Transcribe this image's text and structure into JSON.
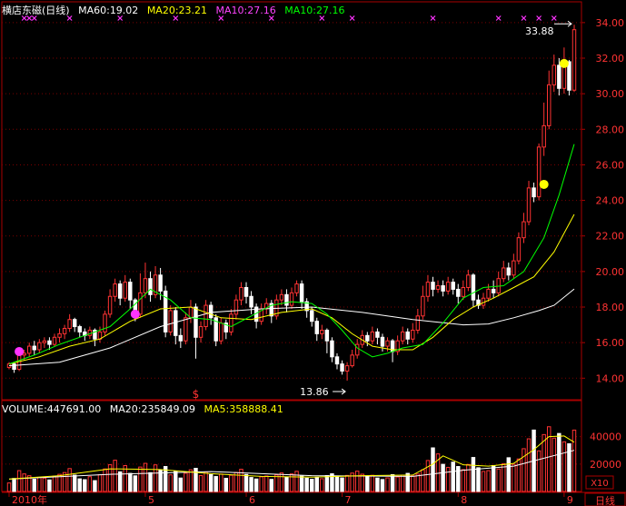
{
  "header": {
    "stock_name": "横店东磁(日线)",
    "indicators": [
      {
        "label": "MA60:19.02",
        "color": "#ffffff"
      },
      {
        "label": "MA20:23.21",
        "color": "#ffff00"
      },
      {
        "label": "MA10:27.16",
        "color": "#ff44ff"
      },
      {
        "label": "MA10:27.16",
        "color": "#00ff00"
      }
    ]
  },
  "volume_header": {
    "indicators": [
      {
        "label": "VOLUME:447691.00",
        "color": "#ffffff"
      },
      {
        "label": "MA20:235849.09",
        "color": "#ffffff"
      },
      {
        "label": "MA5:358888.41",
        "color": "#ffff00"
      }
    ]
  },
  "colors": {
    "up": "#ff3333",
    "down": "#ffffff",
    "border": "#aa0000",
    "grid": "#7a0000",
    "axis_text": "#ff3333",
    "ma_white": "#ffffff",
    "ma_yellow": "#ffff00",
    "ma_green": "#00ff00",
    "marker_yellow": "#ffff00",
    "marker_magenta": "#ff33ff",
    "signal_mark": "#ff33ff"
  },
  "chart_data": {
    "type": "candlestick",
    "price_axis": {
      "min": 13.3,
      "max": 34.3,
      "ticks": [
        "14.00",
        "16.00",
        "18.00",
        "20.00",
        "22.00",
        "24.00",
        "26.00",
        "28.00",
        "30.00",
        "32.00",
        "34.00"
      ]
    },
    "volume_axis": {
      "max": 55000,
      "ticks": [
        "20000",
        "40000"
      ],
      "unit": "X10"
    },
    "x_axis": {
      "labels": [
        {
          "label": "2010年",
          "index": 0
        },
        {
          "label": "5",
          "index": 27
        },
        {
          "label": "6",
          "index": 47
        },
        {
          "label": "7",
          "index": 66
        },
        {
          "label": "8",
          "index": 89
        },
        {
          "label": "9",
          "index": 110
        }
      ],
      "period_button": "日线"
    },
    "annotations": {
      "low_label": "13.86",
      "high_label": "33.88",
      "low_index": 67,
      "low_price": 13.86,
      "high_index": 112,
      "high_price": 33.88,
      "event_symbol": "$",
      "event_index": 37
    },
    "markers": [
      {
        "index": 2,
        "price": 15.5,
        "color": "magenta"
      },
      {
        "index": 25,
        "price": 17.6,
        "color": "magenta"
      },
      {
        "index": 106,
        "price": 24.9,
        "color": "yellow"
      },
      {
        "index": 110,
        "price": 31.7,
        "color": "yellow"
      }
    ],
    "top_signals": [
      3,
      4,
      5,
      12,
      22,
      33,
      42,
      52,
      62,
      68,
      84,
      97,
      102,
      105,
      108
    ],
    "candles": [
      [
        14.6,
        14.8,
        14.5,
        14.9
      ],
      [
        14.8,
        14.5,
        14.3,
        14.9
      ],
      [
        14.5,
        15.3,
        14.4,
        15.5
      ],
      [
        15.3,
        15.4,
        15.0,
        15.6
      ],
      [
        15.4,
        15.8,
        15.2,
        16.0
      ],
      [
        15.8,
        15.6,
        15.3,
        16.1
      ],
      [
        15.6,
        16.0,
        15.4,
        16.2
      ],
      [
        16.0,
        16.1,
        15.7,
        16.3
      ],
      [
        16.1,
        15.9,
        15.6,
        16.3
      ],
      [
        15.9,
        16.3,
        15.8,
        16.5
      ],
      [
        16.3,
        16.5,
        16.0,
        16.8
      ],
      [
        16.5,
        16.8,
        16.2,
        17.0
      ],
      [
        16.8,
        17.3,
        16.6,
        17.6
      ],
      [
        17.3,
        16.9,
        16.6,
        17.4
      ],
      [
        16.9,
        16.6,
        16.3,
        17.0
      ],
      [
        16.6,
        16.4,
        16.1,
        16.8
      ],
      [
        16.4,
        16.7,
        16.2,
        16.9
      ],
      [
        16.7,
        16.2,
        15.8,
        16.8
      ],
      [
        16.2,
        16.6,
        16.0,
        16.9
      ],
      [
        16.6,
        17.6,
        16.4,
        17.8
      ],
      [
        17.6,
        18.6,
        17.4,
        19.0
      ],
      [
        18.6,
        19.3,
        18.3,
        19.6
      ],
      [
        19.3,
        18.5,
        18.1,
        19.5
      ],
      [
        18.5,
        19.4,
        18.3,
        19.8
      ],
      [
        19.4,
        18.4,
        17.9,
        19.6
      ],
      [
        18.4,
        17.6,
        17.2,
        18.5
      ],
      [
        17.6,
        18.8,
        17.4,
        19.9
      ],
      [
        18.8,
        19.6,
        18.5,
        20.5
      ],
      [
        19.6,
        18.7,
        18.3,
        20.0
      ],
      [
        18.7,
        19.8,
        18.5,
        20.3
      ],
      [
        19.8,
        18.9,
        18.4,
        20.2
      ],
      [
        18.9,
        16.6,
        16.3,
        19.2
      ],
      [
        16.6,
        17.8,
        16.4,
        18.1
      ],
      [
        17.8,
        16.4,
        15.9,
        18.0
      ],
      [
        16.4,
        16.1,
        15.7,
        16.8
      ],
      [
        16.1,
        17.4,
        15.9,
        17.7
      ],
      [
        17.4,
        18.0,
        17.1,
        18.4
      ],
      [
        18.0,
        16.3,
        15.1,
        18.2
      ],
      [
        16.3,
        16.9,
        16.0,
        17.2
      ],
      [
        16.9,
        18.1,
        16.7,
        18.4
      ],
      [
        18.1,
        17.4,
        17.0,
        18.3
      ],
      [
        17.4,
        16.1,
        15.8,
        17.6
      ],
      [
        16.1,
        17.1,
        15.9,
        17.4
      ],
      [
        17.1,
        16.6,
        16.2,
        17.3
      ],
      [
        16.6,
        17.6,
        16.4,
        17.9
      ],
      [
        17.6,
        18.4,
        17.3,
        18.7
      ],
      [
        18.4,
        19.1,
        18.1,
        19.4
      ],
      [
        19.1,
        18.6,
        18.2,
        19.4
      ],
      [
        18.6,
        18.0,
        17.6,
        18.9
      ],
      [
        18.0,
        17.2,
        16.8,
        18.2
      ],
      [
        17.2,
        17.9,
        17.0,
        18.2
      ],
      [
        17.9,
        18.2,
        17.6,
        18.5
      ],
      [
        18.2,
        17.5,
        17.1,
        18.4
      ],
      [
        17.5,
        18.4,
        17.3,
        18.7
      ],
      [
        18.4,
        18.7,
        18.1,
        19.0
      ],
      [
        18.7,
        18.1,
        17.7,
        19.0
      ],
      [
        18.1,
        18.8,
        17.9,
        19.1
      ],
      [
        18.8,
        19.3,
        18.6,
        19.5
      ],
      [
        19.3,
        18.3,
        17.9,
        19.5
      ],
      [
        18.3,
        17.8,
        17.4,
        18.5
      ],
      [
        17.8,
        17.2,
        16.9,
        18.0
      ],
      [
        17.2,
        16.5,
        16.1,
        17.4
      ],
      [
        16.5,
        16.7,
        16.2,
        17.0
      ],
      [
        16.7,
        16.1,
        15.4,
        16.8
      ],
      [
        16.1,
        15.2,
        14.9,
        16.3
      ],
      [
        15.2,
        14.8,
        14.5,
        15.4
      ],
      [
        14.8,
        14.4,
        14.2,
        15.0
      ],
      [
        14.4,
        14.7,
        13.86,
        14.9
      ],
      [
        14.7,
        15.3,
        14.6,
        15.6
      ],
      [
        15.3,
        15.9,
        15.1,
        16.2
      ],
      [
        15.9,
        16.4,
        15.7,
        16.7
      ],
      [
        16.4,
        16.1,
        15.8,
        16.6
      ],
      [
        16.1,
        16.6,
        15.9,
        16.9
      ],
      [
        16.6,
        16.3,
        15.9,
        16.8
      ],
      [
        16.3,
        15.8,
        15.5,
        16.5
      ],
      [
        15.8,
        16.1,
        15.5,
        16.3
      ],
      [
        16.1,
        15.5,
        14.9,
        16.2
      ],
      [
        15.5,
        16.1,
        15.3,
        16.4
      ],
      [
        16.1,
        16.6,
        15.9,
        16.9
      ],
      [
        16.6,
        16.2,
        15.9,
        16.8
      ],
      [
        16.2,
        16.7,
        16.0,
        17.1
      ],
      [
        16.7,
        17.5,
        16.5,
        17.9
      ],
      [
        17.5,
        18.6,
        17.3,
        19.2
      ],
      [
        18.6,
        19.4,
        18.3,
        19.8
      ],
      [
        19.4,
        19.0,
        18.6,
        19.7
      ],
      [
        19.0,
        19.2,
        18.8,
        19.5
      ],
      [
        19.2,
        18.9,
        18.6,
        19.5
      ],
      [
        18.9,
        19.4,
        18.7,
        19.7
      ],
      [
        19.4,
        19.0,
        18.7,
        19.6
      ],
      [
        19.0,
        18.6,
        18.2,
        19.3
      ],
      [
        18.6,
        19.1,
        18.4,
        19.5
      ],
      [
        19.1,
        19.8,
        18.9,
        20.1
      ],
      [
        19.8,
        18.4,
        18.0,
        19.9
      ],
      [
        18.4,
        18.1,
        17.9,
        18.7
      ],
      [
        18.1,
        18.5,
        17.9,
        18.8
      ],
      [
        18.5,
        19.0,
        18.3,
        19.3
      ],
      [
        19.0,
        18.8,
        18.5,
        19.5
      ],
      [
        18.8,
        19.6,
        18.6,
        20.0
      ],
      [
        19.6,
        20.2,
        19.4,
        20.6
      ],
      [
        20.2,
        19.8,
        19.5,
        20.5
      ],
      [
        19.8,
        20.6,
        19.6,
        21.0
      ],
      [
        20.6,
        21.9,
        20.4,
        22.2
      ],
      [
        21.9,
        22.8,
        21.6,
        23.3
      ],
      [
        22.8,
        24.7,
        22.6,
        25.1
      ],
      [
        24.7,
        24.2,
        23.9,
        25.0
      ],
      [
        24.2,
        27.0,
        24.0,
        27.2
      ],
      [
        27.0,
        28.2,
        26.5,
        29.5
      ],
      [
        28.2,
        30.5,
        28.0,
        31.3
      ],
      [
        30.5,
        31.6,
        30.1,
        32.2
      ],
      [
        31.6,
        30.3,
        29.9,
        32.0
      ],
      [
        30.3,
        31.8,
        30.0,
        32.6
      ],
      [
        31.8,
        30.2,
        29.9,
        31.9
      ],
      [
        30.2,
        33.6,
        30.1,
        33.88
      ]
    ],
    "volumes": [
      6200,
      9500,
      15200,
      12800,
      11500,
      8900,
      10300,
      9700,
      8400,
      11200,
      12500,
      13800,
      16700,
      11900,
      9200,
      8600,
      10800,
      7900,
      12200,
      16400,
      19500,
      22800,
      14300,
      18900,
      13200,
      11400,
      17800,
      20500,
      13700,
      19400,
      15600,
      18200,
      12100,
      14900,
      9800,
      13300,
      15800,
      16900,
      11600,
      14200,
      12300,
      10900,
      12700,
      9600,
      11800,
      13900,
      16200,
      12400,
      10200,
      9100,
      10700,
      11300,
      8800,
      12100,
      13500,
      10600,
      12800,
      14700,
      11200,
      9700,
      8900,
      10400,
      9300,
      11600,
      12900,
      10800,
      9900,
      11700,
      13400,
      14800,
      12600,
      10900,
      11800,
      9800,
      8700,
      9900,
      12300,
      10600,
      11900,
      13200,
      11400,
      12700,
      15800,
      22600,
      31800,
      27400,
      19800,
      17600,
      21400,
      18200,
      15900,
      19700,
      24800,
      17300,
      14600,
      15200,
      18900,
      16400,
      20300,
      24600,
      19800,
      23700,
      31200,
      38400,
      44800,
      29600,
      41500,
      47200,
      38900,
      42300,
      36200,
      34800,
      44769
    ],
    "series": [
      {
        "name": "MA60",
        "color_key": "ma_white",
        "points": [
          [
            0,
            14.7
          ],
          [
            10,
            14.9
          ],
          [
            20,
            15.7
          ],
          [
            30,
            16.9
          ],
          [
            40,
            17.7
          ],
          [
            50,
            17.9
          ],
          [
            60,
            18.0
          ],
          [
            70,
            17.7
          ],
          [
            80,
            17.3
          ],
          [
            90,
            17.0
          ],
          [
            95,
            17.05
          ],
          [
            100,
            17.4
          ],
          [
            105,
            17.8
          ],
          [
            108,
            18.1
          ],
          [
            112,
            19.02
          ]
        ]
      },
      {
        "name": "MA20",
        "color_key": "ma_yellow",
        "points": [
          [
            0,
            14.8
          ],
          [
            6,
            15.2
          ],
          [
            12,
            15.8
          ],
          [
            18,
            16.2
          ],
          [
            24,
            17.2
          ],
          [
            30,
            17.9
          ],
          [
            36,
            18.0
          ],
          [
            42,
            17.4
          ],
          [
            48,
            17.3
          ],
          [
            54,
            17.7
          ],
          [
            60,
            17.9
          ],
          [
            64,
            17.4
          ],
          [
            68,
            16.5
          ],
          [
            72,
            15.8
          ],
          [
            76,
            15.6
          ],
          [
            80,
            15.6
          ],
          [
            84,
            16.3
          ],
          [
            88,
            17.3
          ],
          [
            92,
            18.0
          ],
          [
            96,
            18.5
          ],
          [
            100,
            19.1
          ],
          [
            104,
            19.7
          ],
          [
            108,
            21.1
          ],
          [
            112,
            23.21
          ]
        ]
      },
      {
        "name": "MA10",
        "color_key": "ma_green",
        "points": [
          [
            0,
            14.8
          ],
          [
            5,
            15.3
          ],
          [
            10,
            15.9
          ],
          [
            15,
            16.4
          ],
          [
            20,
            16.9
          ],
          [
            24,
            17.9
          ],
          [
            28,
            19.0
          ],
          [
            32,
            18.4
          ],
          [
            36,
            17.4
          ],
          [
            40,
            17.3
          ],
          [
            44,
            16.9
          ],
          [
            48,
            17.5
          ],
          [
            52,
            18.1
          ],
          [
            56,
            18.3
          ],
          [
            60,
            18.2
          ],
          [
            63,
            17.6
          ],
          [
            66,
            16.7
          ],
          [
            69,
            15.7
          ],
          [
            72,
            15.2
          ],
          [
            75,
            15.4
          ],
          [
            78,
            15.7
          ],
          [
            82,
            15.9
          ],
          [
            86,
            17.1
          ],
          [
            90,
            18.5
          ],
          [
            94,
            19.1
          ],
          [
            98,
            19.2
          ],
          [
            102,
            20.0
          ],
          [
            106,
            21.9
          ],
          [
            109,
            24.3
          ],
          [
            112,
            27.16
          ]
        ]
      },
      {
        "name": "VOL_MA20",
        "color_key": "ma_white",
        "points": [
          [
            0,
            9000
          ],
          [
            20,
            12500
          ],
          [
            40,
            14500
          ],
          [
            60,
            11500
          ],
          [
            80,
            11000
          ],
          [
            90,
            15500
          ],
          [
            100,
            18500
          ],
          [
            112,
            30000
          ]
        ]
      },
      {
        "name": "VOL_MA5",
        "color_key": "ma_yellow",
        "points": [
          [
            0,
            9000
          ],
          [
            10,
            11500
          ],
          [
            20,
            16500
          ],
          [
            30,
            16000
          ],
          [
            40,
            13000
          ],
          [
            50,
            11000
          ],
          [
            60,
            10500
          ],
          [
            70,
            11500
          ],
          [
            80,
            12000
          ],
          [
            84,
            20000
          ],
          [
            86,
            26000
          ],
          [
            90,
            19500
          ],
          [
            95,
            18500
          ],
          [
            100,
            20500
          ],
          [
            104,
            30500
          ],
          [
            107,
            40000
          ],
          [
            110,
            40500
          ],
          [
            112,
            35900
          ]
        ]
      }
    ]
  }
}
